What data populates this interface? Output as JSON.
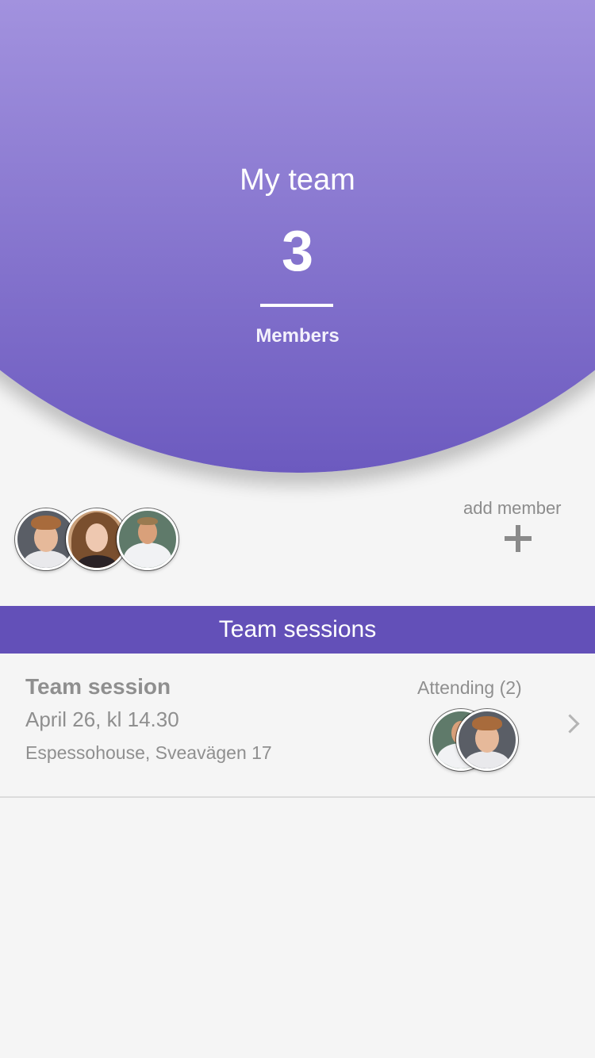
{
  "hero": {
    "title": "My team",
    "member_count": "3",
    "members_label": "Members"
  },
  "members": {
    "avatars": [
      "member-avatar-1",
      "member-avatar-2",
      "member-avatar-3"
    ],
    "add_member_label": "add member",
    "add_icon": "plus-icon"
  },
  "team_sessions": {
    "header": "Team sessions",
    "sessions": [
      {
        "title": "Team session",
        "date": "April 26, kl 14.30",
        "place": "Espessohouse, Sveavägen 17",
        "attending_label": "Attending (2)",
        "chevron_icon": "chevron-right-icon"
      }
    ]
  },
  "colors": {
    "accent": "#6350b8",
    "hero_top": "#a393df",
    "hero_bottom": "#6c5abf",
    "background": "#f5f5f5",
    "muted_text": "#8f8f8f"
  }
}
